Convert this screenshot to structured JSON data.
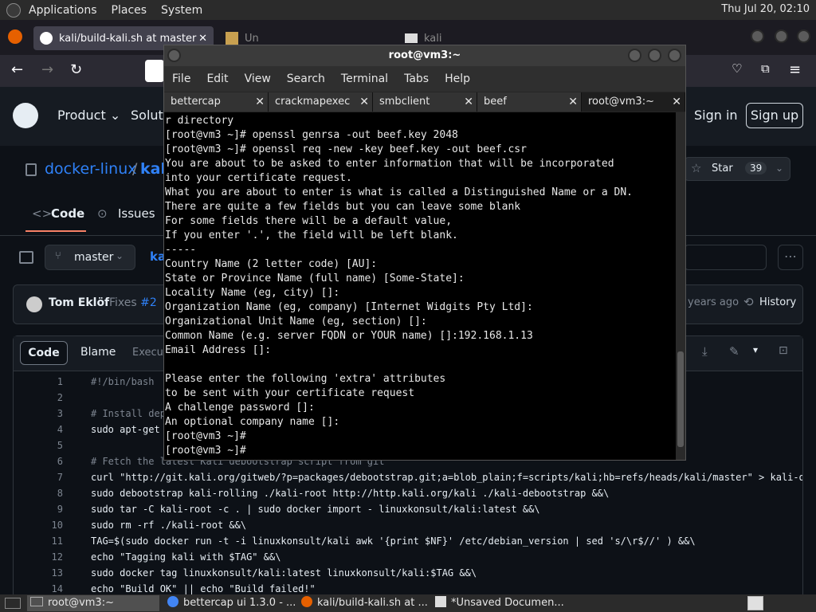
{
  "top_panel": {
    "menus": [
      "Applications",
      "Places",
      "System"
    ],
    "clock": "Thu Jul 20, 02:10"
  },
  "firefox": {
    "tabs": [
      {
        "label": "kali/build-kali.sh at master"
      },
      {
        "label": "Un"
      },
      {
        "label": "kali"
      }
    ]
  },
  "github": {
    "nav": {
      "product": "Product",
      "solutions": "Soluti",
      "sign_in": "Sign in",
      "sign_up": "Sign up"
    },
    "repo": {
      "owner": "docker-linux",
      "name_fragment": "kal"
    },
    "star": {
      "label": "Star",
      "count": "39"
    },
    "tabs": {
      "code": "Code",
      "issues": "Issues"
    },
    "branch": "master",
    "path_fragment": "ka",
    "commit": {
      "author": "Tom Eklöf",
      "message_prefix": "Fixes",
      "issue": "#2",
      "time": "years ago",
      "history": "History"
    },
    "viewer_tabs": {
      "code": "Code",
      "blame": "Blame",
      "exec": "Execu"
    },
    "code_lines": [
      {
        "n": "1",
        "text": "#!/bin/bash"
      },
      {
        "n": "2",
        "text": ""
      },
      {
        "n": "3",
        "text": "# Install deper"
      },
      {
        "n": "4",
        "text": "sudo apt-get ir"
      },
      {
        "n": "5",
        "text": ""
      },
      {
        "n": "6",
        "text": "# Fetch the latest Kali debootstrap script from git"
      },
      {
        "n": "7",
        "text": "curl \"http://git.kali.org/gitweb/?p=packages/debootstrap.git;a=blob_plain;f=scripts/kali;hb=refs/heads/kali/master\" > kali-debo"
      },
      {
        "n": "8",
        "text": "sudo debootstrap kali-rolling ./kali-root http://http.kali.org/kali ./kali-debootstrap &&\\"
      },
      {
        "n": "9",
        "text": "sudo tar -C kali-root -c . | sudo docker import - linuxkonsult/kali:latest &&\\"
      },
      {
        "n": "10",
        "text": "sudo rm -rf ./kali-root &&\\"
      },
      {
        "n": "11",
        "text": "TAG=$(sudo docker run -t -i linuxkonsult/kali awk '{print $NF}' /etc/debian_version | sed 's/\\r$//' ) &&\\"
      },
      {
        "n": "12",
        "text": "echo \"Tagging kali with $TAG\" &&\\"
      },
      {
        "n": "13",
        "text": "sudo docker tag linuxkonsult/kali:latest linuxkonsult/kali:$TAG &&\\"
      },
      {
        "n": "14",
        "text": "echo \"Build OK\" || echo \"Build failed!\""
      }
    ]
  },
  "terminal": {
    "title": "root@vm3:~",
    "menu": [
      "File",
      "Edit",
      "View",
      "Search",
      "Terminal",
      "Tabs",
      "Help"
    ],
    "tabs": [
      "bettercap",
      "crackmapexec",
      "smbclient",
      "beef",
      "root@vm3:~"
    ],
    "lines": [
      "r directory",
      "[root@vm3 ~]# openssl genrsa -out beef.key 2048",
      "[root@vm3 ~]# openssl req -new -key beef.key -out beef.csr",
      "You are about to be asked to enter information that will be incorporated",
      "into your certificate request.",
      "What you are about to enter is what is called a Distinguished Name or a DN.",
      "There are quite a few fields but you can leave some blank",
      "For some fields there will be a default value,",
      "If you enter '.', the field will be left blank.",
      "-----",
      "Country Name (2 letter code) [AU]:",
      "State or Province Name (full name) [Some-State]:",
      "Locality Name (eg, city) []:",
      "Organization Name (eg, company) [Internet Widgits Pty Ltd]:",
      "Organizational Unit Name (eg, section) []:",
      "Common Name (e.g. server FQDN or YOUR name) []:192.168.1.13",
      "Email Address []:",
      "",
      "Please enter the following 'extra' attributes",
      "to be sent with your certificate request",
      "A challenge password []:",
      "An optional company name []:",
      "[root@vm3 ~]#",
      "[root@vm3 ~]#"
    ]
  },
  "taskbar": [
    {
      "label": "root@vm3:~"
    },
    {
      "label": "bettercap ui 1.3.0 - ..."
    },
    {
      "label": "kali/build-kali.sh at ..."
    },
    {
      "label": "*Unsaved Documen..."
    }
  ]
}
